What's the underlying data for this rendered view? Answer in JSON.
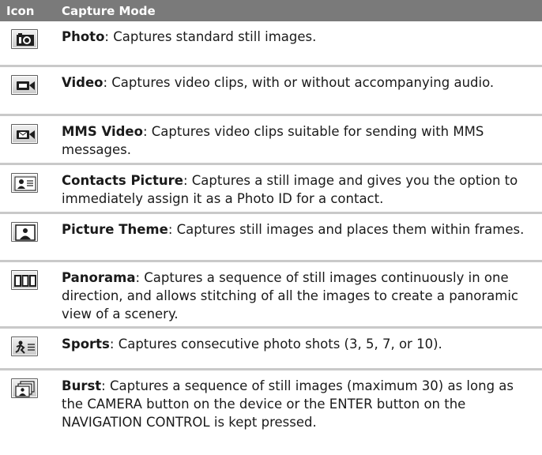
{
  "table": {
    "header": {
      "icon_col": "Icon",
      "mode_col": "Capture Mode"
    },
    "rows": [
      {
        "icon": "camera-icon",
        "name": "Photo",
        "desc": ": Captures standard still images."
      },
      {
        "icon": "video-camera-icon",
        "name": "Video",
        "desc": ": Captures video clips, with or without accompanying audio."
      },
      {
        "icon": "mms-video-icon",
        "name": "MMS Video",
        "desc": ": Captures video clips suitable for sending with MMS messages."
      },
      {
        "icon": "contact-card-icon",
        "name": "Contacts Picture",
        "desc": ": Captures a still image and gives you the option to immediately assign it as a Photo ID for a contact."
      },
      {
        "icon": "picture-frame-icon",
        "name": "Picture Theme",
        "desc": ": Captures still images and places them within frames."
      },
      {
        "icon": "panorama-icon",
        "name": "Panorama",
        "desc": ": Captures a sequence of still images continuously in one direction, and allows stitching of all the images to create a panoramic view of a scenery."
      },
      {
        "icon": "sports-icon",
        "name": "Sports",
        "desc": ": Captures consecutive photo shots (3, 5, 7, or 10)."
      },
      {
        "icon": "burst-icon",
        "name": "Burst",
        "desc": ": Captures a sequence of still images (maximum 30) as long as the CAMERA button on the device or the ENTER button on the NAVIGATION CONTROL is kept pressed."
      }
    ]
  }
}
